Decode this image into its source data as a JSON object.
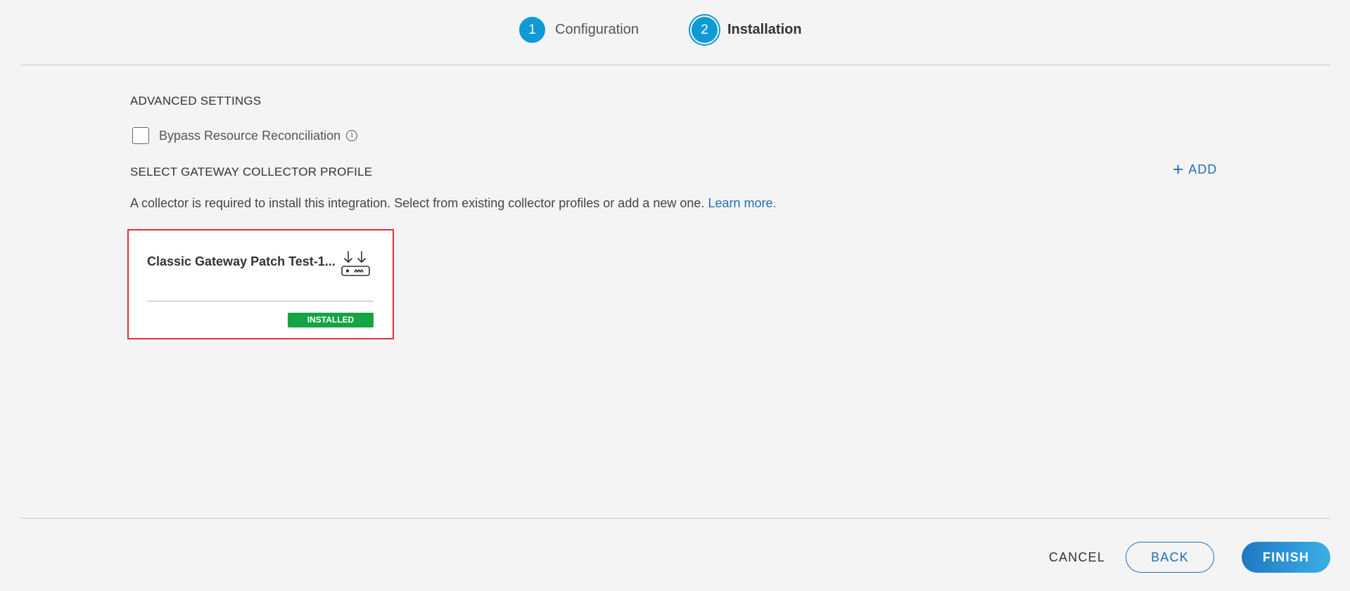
{
  "stepper": {
    "steps": [
      {
        "number": "1",
        "label": "Configuration"
      },
      {
        "number": "2",
        "label": "Installation"
      }
    ]
  },
  "advanced": {
    "title": "ADVANCED SETTINGS",
    "checkbox_label": "Bypass Resource Reconciliation",
    "checked": false
  },
  "collector": {
    "title": "SELECT GATEWAY COLLECTOR PROFILE",
    "add_label": "ADD",
    "description": "A collector is required to install this integration. Select from existing collector profiles or add a new one.",
    "learn_more": "Learn more.",
    "cards": [
      {
        "name": "Classic Gateway Patch Test-1...",
        "status": "INSTALLED",
        "icon": "gateway-icon"
      }
    ]
  },
  "footer": {
    "cancel": "CANCEL",
    "back": "BACK",
    "finish": "FINISH"
  },
  "colors": {
    "accent": "#0e9ad7",
    "link": "#1f6fb8",
    "installed": "#16a344",
    "selected_border": "#e0313a"
  }
}
